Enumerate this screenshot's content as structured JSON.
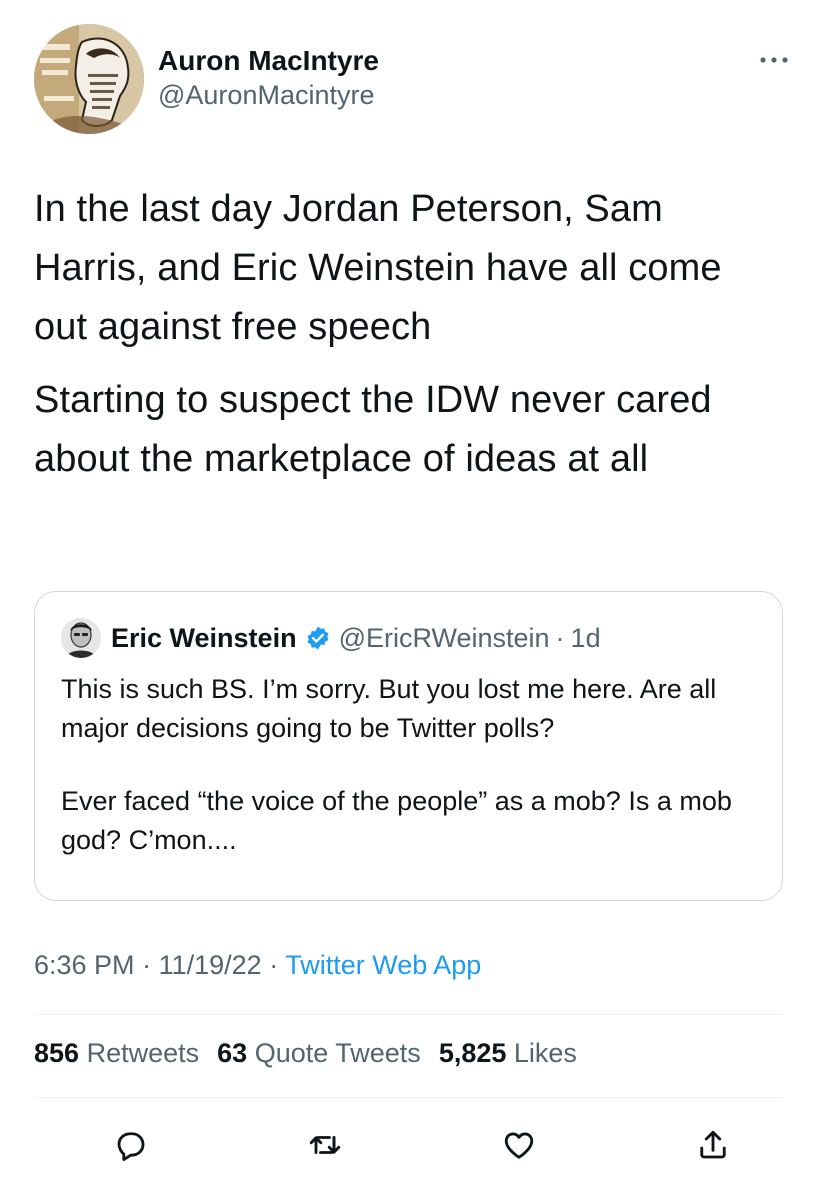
{
  "tweet": {
    "author": {
      "display_name": "Auron MacIntyre",
      "handle": "@AuronMacintyre"
    },
    "text_paragraphs": [
      "In the last day Jordan Peterson, Sam Harris, and Eric Weinstein have all come out against free speech",
      "Starting to suspect the IDW never cared about the marketplace of ideas at all"
    ],
    "more_icon": "more-horizontal-icon"
  },
  "quote": {
    "display_name": "Eric Weinstein",
    "verified_icon": "verified-badge-icon",
    "handle": "@EricRWeinstein",
    "separator": "·",
    "time": "1d",
    "paragraphs": [
      "This is such BS. I’m sorry. But you lost me here. Are all major decisions going to be Twitter polls?",
      "Ever faced “the voice of the people” as a mob? Is a mob god? C’mon...."
    ]
  },
  "meta": {
    "time": "6:36 PM",
    "separator": "·",
    "date": "11/19/22",
    "source": "Twitter Web App"
  },
  "stats": {
    "retweets": {
      "count": "856",
      "label": "Retweets"
    },
    "quotes": {
      "count": "63",
      "label": "Quote Tweets"
    },
    "likes": {
      "count": "5,825",
      "label": "Likes"
    }
  },
  "actions": [
    "reply-icon",
    "retweet-icon",
    "like-icon",
    "share-icon"
  ],
  "colors": {
    "text": "#0f1419",
    "secondary": "#536471",
    "link": "#1d9bf0",
    "border": "#cfd9de",
    "divider": "#eff3f4"
  }
}
